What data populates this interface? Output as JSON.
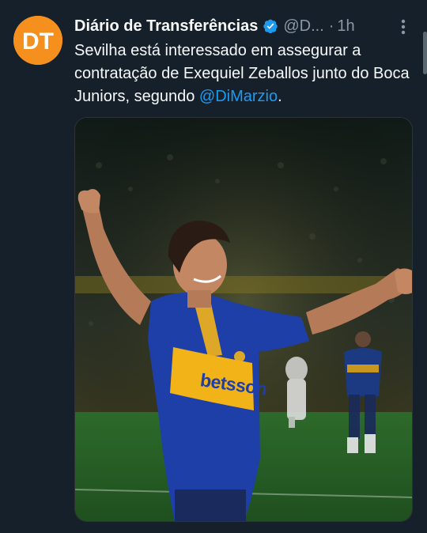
{
  "tweet": {
    "author_name": "Diário de Transferências",
    "handle": "@D...",
    "separator": "·",
    "time": "1h",
    "avatar_initials": "DT",
    "text_before_mention": "Sevilha está interessado em assegurar a contratação de Exequiel Zeballos junto do Boca Juniors, segundo ",
    "mention": "@DiMarzio",
    "text_after_mention": ".",
    "media": {
      "shirt_sponsor": "betsson"
    }
  },
  "icons": {
    "verified": "verified-badge-icon",
    "more": "more-options-icon"
  },
  "colors": {
    "background": "#15202b",
    "text": "#f7f9f9",
    "secondary": "#8b98a5",
    "accent": "#1d9bf0",
    "avatar": "#f5901f"
  }
}
